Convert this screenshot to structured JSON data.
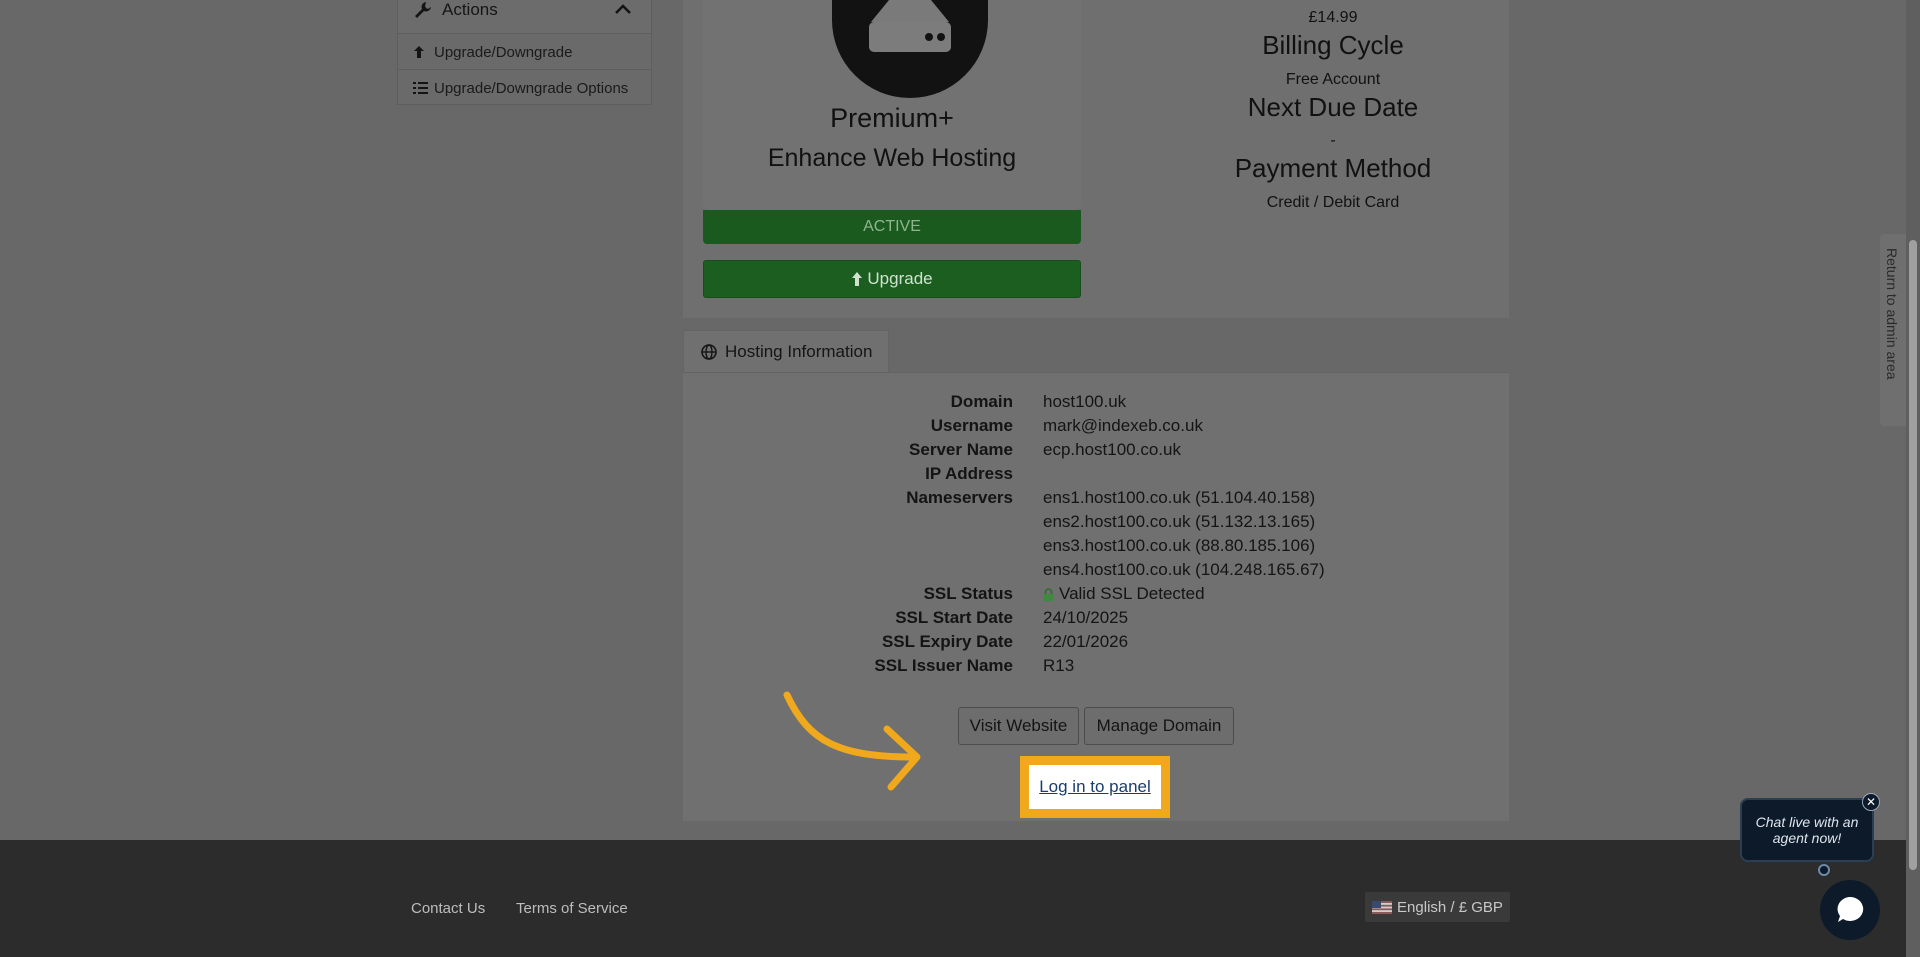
{
  "sidebar": {
    "header": "Actions",
    "items": [
      {
        "label": "Upgrade/Downgrade",
        "icon": "upload-arrow-icon"
      },
      {
        "label": "Upgrade/Downgrade Options",
        "icon": "list-icon"
      }
    ]
  },
  "product": {
    "name": "Premium+",
    "group": "Enhance Web Hosting",
    "status": "ACTIVE",
    "upgrade_label": "Upgrade"
  },
  "billing": {
    "price": "£14.99",
    "cycle_label": "Billing Cycle",
    "cycle_value": "Free Account",
    "next_due_label": "Next Due Date",
    "next_due_value": "-",
    "payment_label": "Payment Method",
    "payment_value": "Credit / Debit Card"
  },
  "hosting": {
    "tab_label": "Hosting Information",
    "rows": [
      {
        "label": "Domain",
        "value": "host100.uk"
      },
      {
        "label": "Username",
        "value": "mark@indexeb.co.uk"
      },
      {
        "label": "Server Name",
        "value": "ecp.host100.co.uk"
      },
      {
        "label": "IP Address",
        "value": ""
      },
      {
        "label": "Nameservers",
        "value": "ens1.host100.co.uk (51.104.40.158)"
      },
      {
        "label": "",
        "value": "ens2.host100.co.uk (51.132.13.165)"
      },
      {
        "label": "",
        "value": "ens3.host100.co.uk (88.80.185.106)"
      },
      {
        "label": "",
        "value": "ens4.host100.co.uk (104.248.165.67)"
      },
      {
        "label": "SSL Status",
        "value": "Valid SSL Detected"
      },
      {
        "label": "SSL Start Date",
        "value": "24/10/2025"
      },
      {
        "label": "SSL Expiry Date",
        "value": "22/01/2026"
      },
      {
        "label": "SSL Issuer Name",
        "value": "R13"
      }
    ],
    "visit_label": "Visit Website",
    "manage_label": "Manage Domain",
    "login_label": "Log in to panel"
  },
  "footer": {
    "contact": "Contact Us",
    "terms": "Terms of Service",
    "language": "English / £ GBP"
  },
  "admin_tab": "Return to admin area",
  "chat": {
    "bubble": "Chat live with an agent now!"
  },
  "colors": {
    "highlight": "#f0a81c",
    "active_green": "#1a5a1e"
  }
}
